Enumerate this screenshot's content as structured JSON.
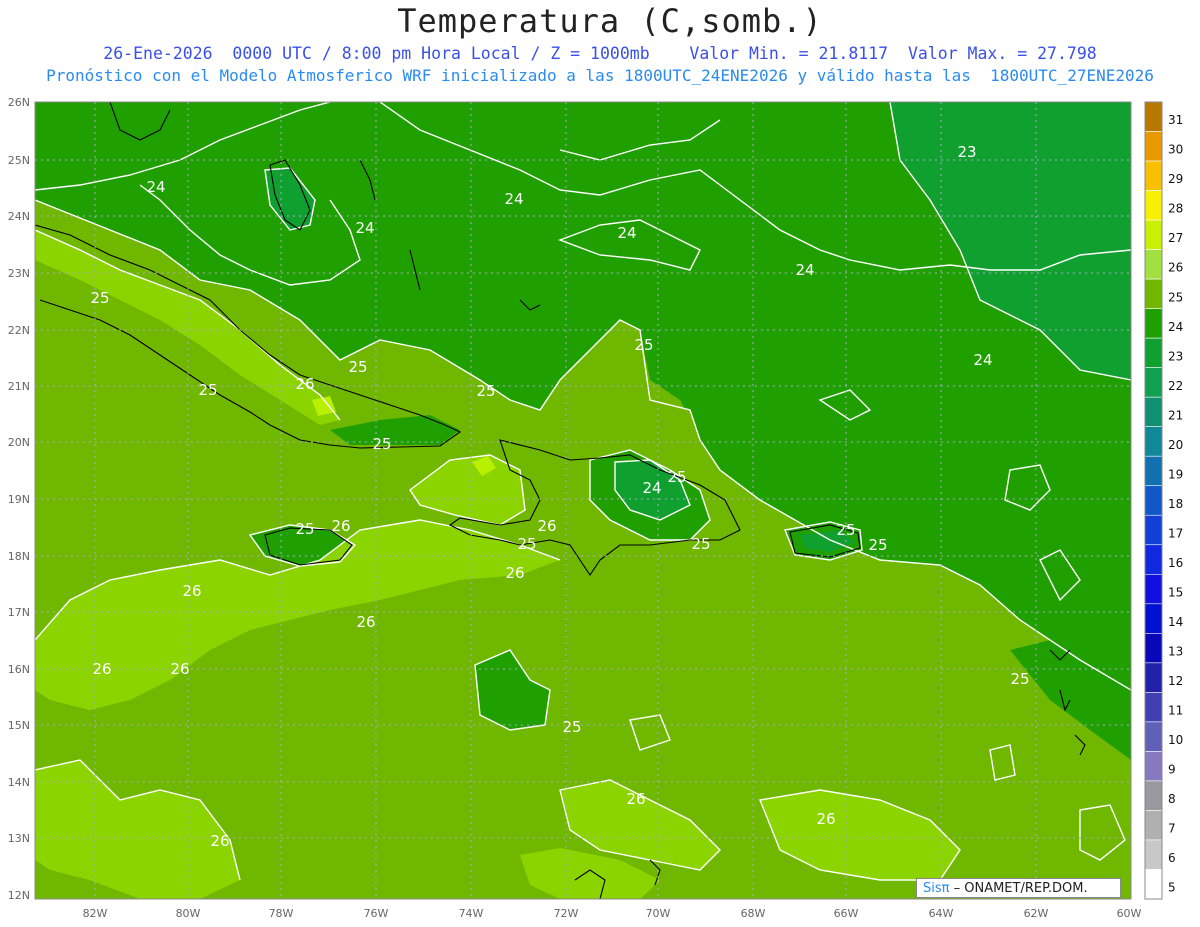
{
  "title": "Temperatura (C,somb.)",
  "subtitle_line1": "26-Ene-2026  0000 UTC / 8:00 pm Hora Local / Z = 1000mb    Valor Min. = 21.8117  Valor Max. = 27.798",
  "subtitle_line2": "Pronóstico con el Modelo Atmosferico WRF inicializado a las 1800UTC_24ENE2026 y válido hasta las  1800UTC_27ENE2026",
  "map": {
    "lat_labels": [
      "26N",
      "25N",
      "24N",
      "23N",
      "22N",
      "21N",
      "20N",
      "19N",
      "18N",
      "17N",
      "16N",
      "15N",
      "14N",
      "13N",
      "12N"
    ],
    "lon_labels": [
      "82W",
      "80W",
      "78W",
      "76W",
      "74W",
      "72W",
      "70W",
      "68W",
      "66W",
      "64W",
      "62W",
      "60W"
    ],
    "contour_labels": [
      {
        "text": "24"
      },
      {
        "text": "24"
      },
      {
        "text": "24"
      },
      {
        "text": "24"
      },
      {
        "text": "24"
      },
      {
        "text": "24"
      },
      {
        "text": "23"
      },
      {
        "text": "25"
      },
      {
        "text": "25"
      },
      {
        "text": "25"
      },
      {
        "text": "25"
      },
      {
        "text": "25"
      },
      {
        "text": "25"
      },
      {
        "text": "25"
      },
      {
        "text": "25"
      },
      {
        "text": "25"
      },
      {
        "text": "25"
      },
      {
        "text": "25"
      },
      {
        "text": "25"
      },
      {
        "text": "25"
      },
      {
        "text": "25"
      },
      {
        "text": "26"
      },
      {
        "text": "26"
      },
      {
        "text": "26"
      },
      {
        "text": "26"
      },
      {
        "text": "26"
      },
      {
        "text": "26"
      },
      {
        "text": "26"
      },
      {
        "text": "26"
      },
      {
        "text": "26"
      },
      {
        "text": "26"
      },
      {
        "text": "26"
      },
      {
        "text": "24"
      }
    ]
  },
  "colorbar": {
    "levels": [
      "31",
      "30",
      "29",
      "28",
      "27",
      "26",
      "25",
      "24",
      "23",
      "22",
      "21",
      "20",
      "19",
      "18",
      "17",
      "16",
      "15",
      "14",
      "13",
      "12",
      "11",
      "10",
      "9",
      "8",
      "7",
      "6",
      "5"
    ],
    "colors": [
      "#b87800",
      "#e89800",
      "#f8c000",
      "#f8f000",
      "#c8f000",
      "#a0e040",
      "#70b800",
      "#20a000",
      "#10a030",
      "#10a050",
      "#109070",
      "#108898",
      "#1070b0",
      "#1058c8",
      "#1040d8",
      "#1028e0",
      "#1010e0",
      "#0010d0",
      "#0808b8",
      "#2020a8",
      "#4040b0",
      "#6060b8",
      "#8878c0",
      "#9898a0",
      "#b0b0b0",
      "#c8c8c8",
      "#ffffff"
    ]
  },
  "credit": {
    "brand": "Sisπ",
    "text": "– ONAMET/REP.DOM."
  }
}
